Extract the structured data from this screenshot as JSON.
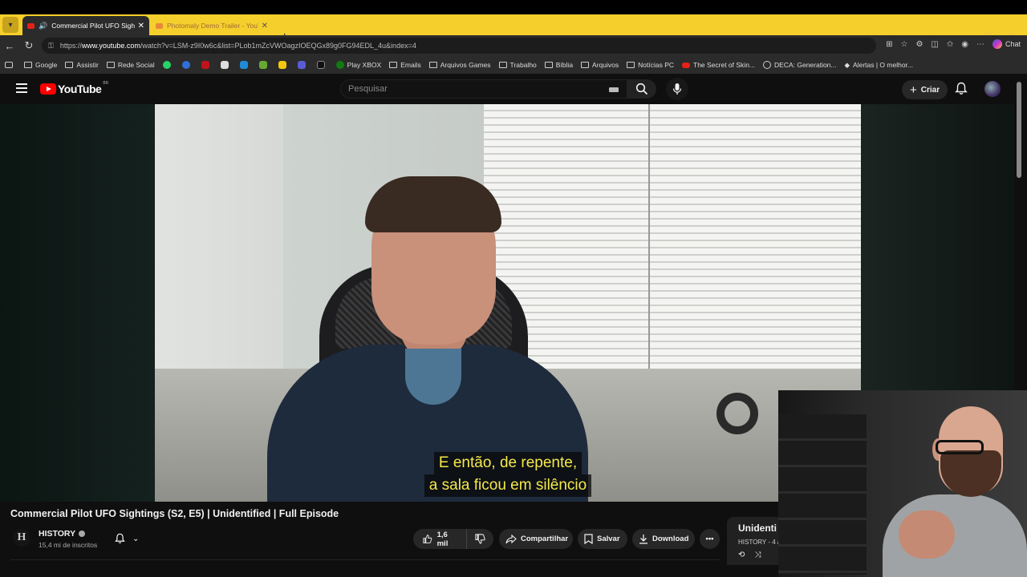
{
  "browser": {
    "tabs": [
      {
        "title": "Commercial Pilot UFO Sightin",
        "active": true
      },
      {
        "title": "Photomaly Demo Trailer - YouTube",
        "active": false
      }
    ],
    "url_prefix": "https://",
    "url_domain": "www.youtube.com",
    "url_path": "/watch?v=LSM-z9I0w6c&list=PLob1mZcVWOagzIOEQGx89g0FG94EDL_4u&index=4",
    "chat_label": "Chat",
    "bookmarks": [
      {
        "label": "Google",
        "icon": "folder-icon"
      },
      {
        "label": "Assistir",
        "icon": "folder-icon"
      },
      {
        "label": "Rede Social",
        "icon": "folder-icon"
      },
      {
        "label": "Play XBOX",
        "icon": "xbox-icon"
      },
      {
        "label": "Emails",
        "icon": "folder-icon"
      },
      {
        "label": "Arquivos Games",
        "icon": "folder-icon"
      },
      {
        "label": "Trabalho",
        "icon": "folder-icon"
      },
      {
        "label": "Bíblia",
        "icon": "folder-icon"
      },
      {
        "label": "Arquivos",
        "icon": "folder-icon"
      },
      {
        "label": "Notícias PC",
        "icon": "folder-icon"
      },
      {
        "label": "The Secret of Skin...",
        "icon": "youtube-icon"
      },
      {
        "label": "DECA: Generation...",
        "icon": "globe-icon"
      },
      {
        "label": "Alertas | O melhor...",
        "icon": "alert-icon"
      }
    ]
  },
  "youtube": {
    "logo_text": "YouTube",
    "region": "BR",
    "search_placeholder": "Pesquisar",
    "create_label": "Criar"
  },
  "video": {
    "subtitle_line1": "E então, de repente,",
    "subtitle_line2": "a sala ficou em silêncio",
    "title": "Commercial Pilot UFO Sightings (S2, E5) | Unidentified | Full Episode"
  },
  "channel": {
    "avatar_letter": "H",
    "name": "HISTORY",
    "subscribers": "15,4 mi de inscritos"
  },
  "actions": {
    "likes": "1,6 mil",
    "share": "Compartilhar",
    "save": "Salvar",
    "download": "Download"
  },
  "playlist": {
    "title": "Unidenti",
    "meta": "HISTORY - 4 /"
  },
  "colors": {
    "tabbar": "#f5cf2b",
    "subtitle": "#f5e94b",
    "brand_red": "#ff0000"
  }
}
